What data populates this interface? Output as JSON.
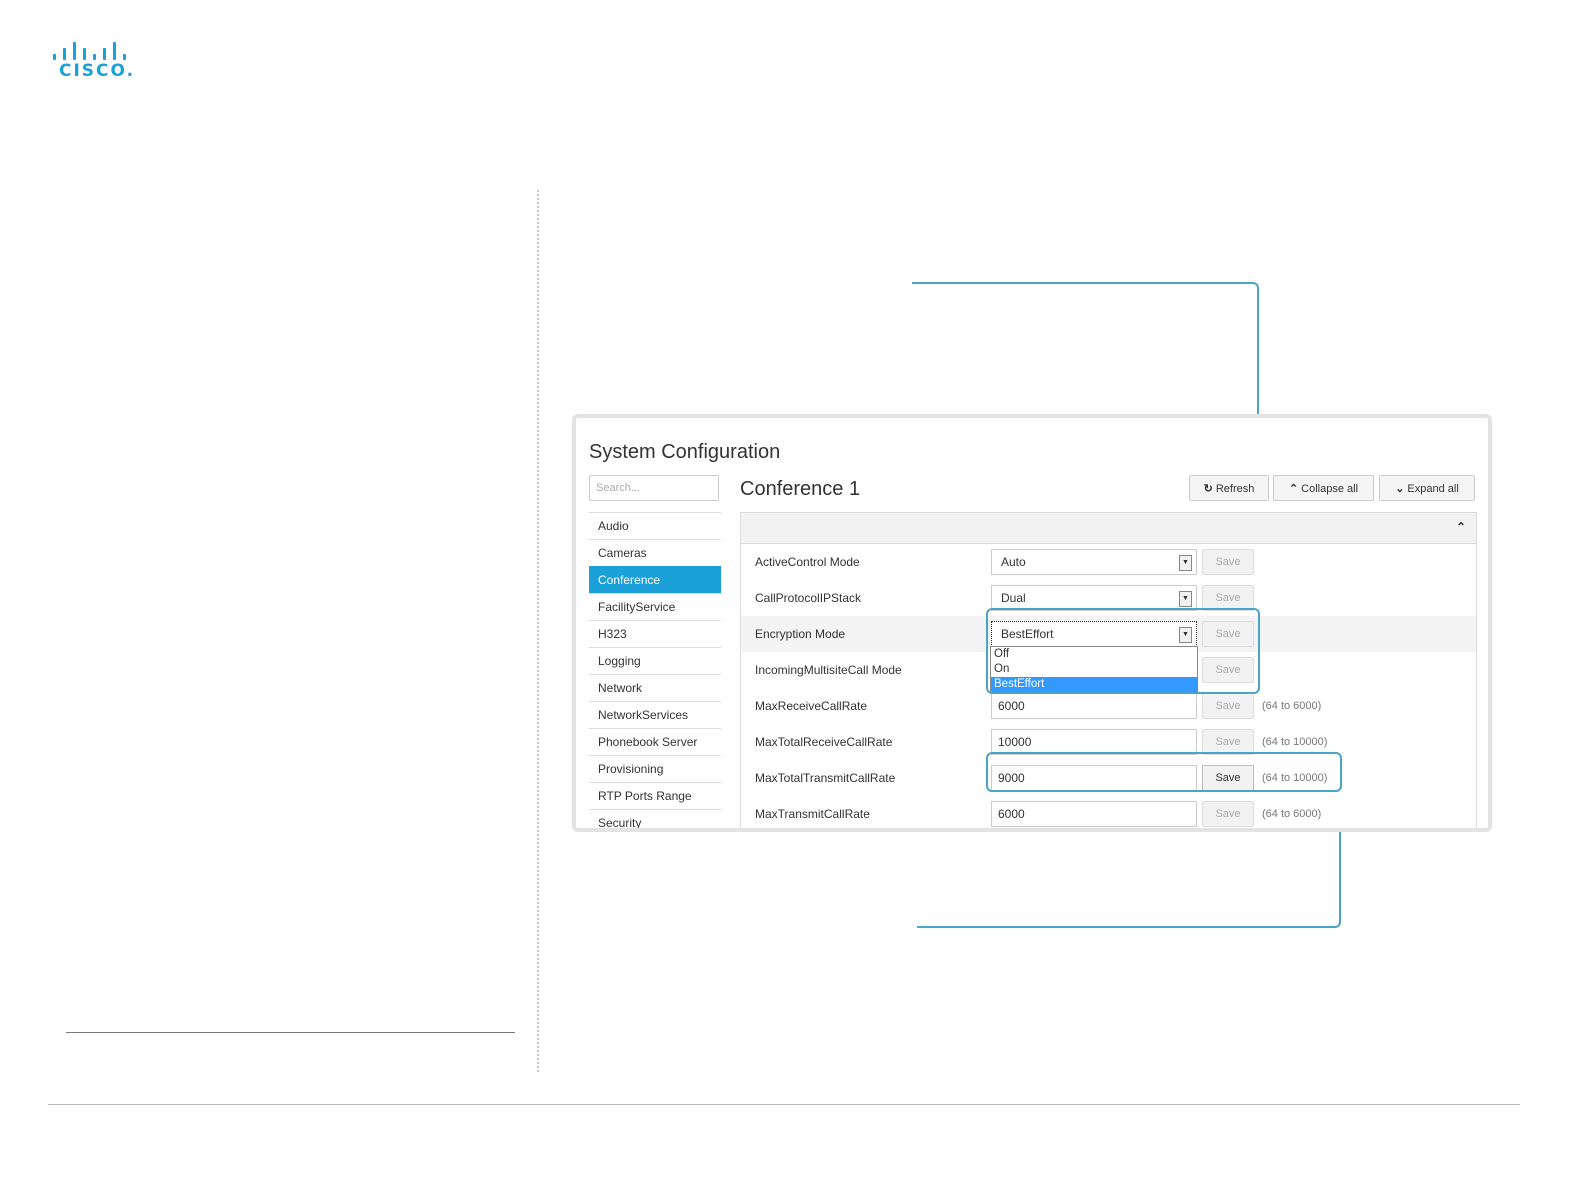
{
  "logo": {
    "text": "cisco"
  },
  "system_config": {
    "title": "System Configuration",
    "search_placeholder": "Search..."
  },
  "sidebar": {
    "items": [
      {
        "label": "Audio"
      },
      {
        "label": "Cameras"
      },
      {
        "label": "Conference",
        "active": true
      },
      {
        "label": "FacilityService"
      },
      {
        "label": "H323"
      },
      {
        "label": "Logging"
      },
      {
        "label": "Network"
      },
      {
        "label": "NetworkServices"
      },
      {
        "label": "Phonebook Server"
      },
      {
        "label": "Provisioning"
      },
      {
        "label": "RTP Ports Range"
      },
      {
        "label": "Security"
      }
    ]
  },
  "section": {
    "title": "Conference 1"
  },
  "toolbar": {
    "refresh_label": "Refresh",
    "collapse_label": "Collapse all",
    "expand_label": "Expand all"
  },
  "rows": [
    {
      "label": "ActiveControl Mode",
      "value": "Auto",
      "save": "Save"
    },
    {
      "label": "CallProtocolIPStack",
      "value": "Dual",
      "save": "Save"
    },
    {
      "label": "Encryption Mode",
      "value": "BestEffort",
      "save": "Save"
    },
    {
      "label": "IncomingMultisiteCall Mode",
      "value": "",
      "save": "Save"
    },
    {
      "label": "MaxReceiveCallRate",
      "value": "6000",
      "save": "Save",
      "range": "(64 to 6000)"
    },
    {
      "label": "MaxTotalReceiveCallRate",
      "value": "10000",
      "save": "Save",
      "range": "(64 to 10000)"
    },
    {
      "label": "MaxTotalTransmitCallRate",
      "value": "9000",
      "save": "Save",
      "range": "(64 to 10000)"
    },
    {
      "label": "MaxTransmitCallRate",
      "value": "6000",
      "save": "Save",
      "range": "(64 to 6000)"
    }
  ],
  "encryption_dropdown": {
    "options": [
      "Off",
      "On",
      "BestEffort"
    ],
    "selected": "BestEffort"
  },
  "colors": {
    "accent": "#1ba0d7",
    "callout": "#4aa3c8",
    "dropdown_selected": "#3399ff"
  }
}
